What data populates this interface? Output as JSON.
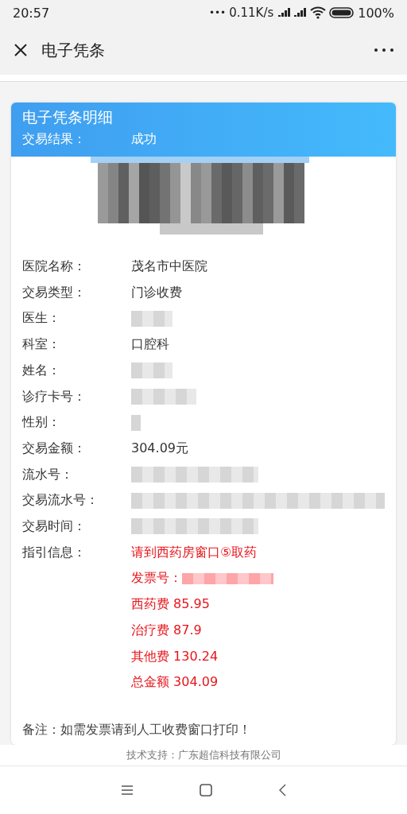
{
  "status_bar": {
    "time": "20:57",
    "dots": "•••",
    "speed": "0.11K/s",
    "battery": "100%"
  },
  "nav": {
    "title": "电子凭条"
  },
  "card": {
    "title": "电子凭条明细",
    "result_label": "交易结果：",
    "result_value": "成功",
    "rows": [
      {
        "label": "医院名称：",
        "kind": "text",
        "value": "茂名市中医院"
      },
      {
        "label": "交易类型：",
        "kind": "text",
        "value": "门诊收费"
      },
      {
        "label": "医生：",
        "kind": "redacted"
      },
      {
        "label": "科室：",
        "kind": "text",
        "value": "口腔科"
      },
      {
        "label": "姓名：",
        "kind": "redacted"
      },
      {
        "label": "诊疗卡号：",
        "kind": "redacted"
      },
      {
        "label": "性别：",
        "kind": "redacted"
      },
      {
        "label": "交易金额：",
        "kind": "text",
        "value": "304.09元"
      },
      {
        "label": "流水号：",
        "kind": "redacted"
      },
      {
        "label": "交易流水号：",
        "kind": "redacted"
      },
      {
        "label": "交易时间：",
        "kind": "redacted"
      }
    ],
    "guide_label": "指引信息：",
    "guide": [
      {
        "text": "请到西药房窗口⑤取药",
        "redacted": false
      },
      {
        "text": "发票号：",
        "redacted": true
      },
      {
        "text": "西药费 85.95",
        "redacted": false
      },
      {
        "text": "治疗费 87.9",
        "redacted": false
      },
      {
        "text": "其他费 130.24",
        "redacted": false
      },
      {
        "text": "总金额 304.09",
        "redacted": false
      }
    ],
    "remark": "备注：如需发票请到人工收费窗口打印！"
  },
  "footer": "技术支持：广东超信科技有限公司"
}
